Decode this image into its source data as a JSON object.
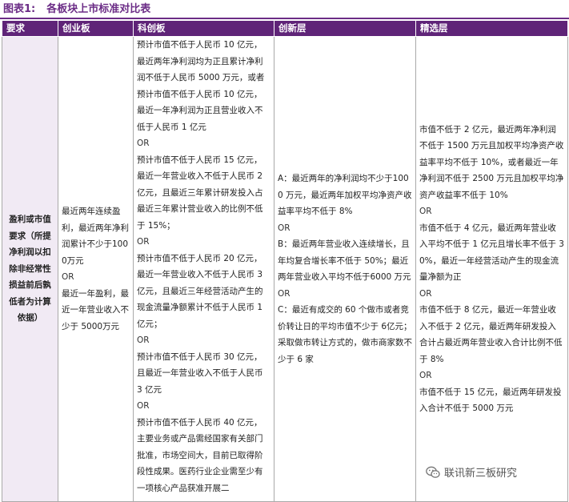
{
  "caption": {
    "label": "图表1:",
    "title": "各板块上市标准对比表"
  },
  "table": {
    "headers": [
      "要求",
      "创业板",
      "科创板",
      "创新层",
      "精选层"
    ],
    "requirement": "盈利或市值要求（所提净利润以扣除非经常性损益前后孰低者为计算依据）",
    "chinext": [
      "最近两年连续盈利，最近两年净利润累计不少于1000万元",
      "OR",
      "最近一年盈利，最近一年营业收入不少于 5000万元"
    ],
    "star": [
      "预计市值不低于人民币 10 亿元，最近两年净利润均为正且累计净利润不低于人民币 5000 万元，或者预计市值不低于人民币 10 亿元，最近一年净利润为正且营业收入不低于人民币 1 亿元",
      "OR",
      "预计市值不低于人民币 15 亿元，最近一年营业收入不低于人民币 2 亿元，且最近三年累计研发投入占最近三年累计营业收入的比例不低于 15%；",
      "OR",
      "预计市值不低于人民币 20 亿元，最近一年营业收入不低于人民币 3 亿元，且最近三年经营活动产生的现金流量净额累计不低于人民币 1 亿元；",
      "OR",
      "预计市值不低于人民币 30 亿元，且最近一年营业收入不低于人民币 3 亿元",
      "OR",
      "预计市值不低于人民币 40 亿元，主要业务或产品需经国家有关部门批准，市场空间大，目前已取得阶段性成果。医药行业企业需至少有一项核心产品获准开展二"
    ],
    "innovation": [
      "A：最近两年的净利润均不少于1000 万元，最近两年加权平均净资产收益率平均不低于 8%",
      "OR",
      "B：最近两年营业收入连续增长，且年均复合增长率不低于 50%；最近两年营业收入平均不低于6000 万元",
      "OR",
      "C：最近有成交的 60 个做市或者竞价转让日的平均市值不少于 6亿元；采取做市转让方式的，做市商家数不少于 6 家"
    ],
    "select": [
      "市值不低于 2 亿元，最近两年净利润不低于 1500 万元且加权平均净资产收益率平均不低于 10%，或者最近一年净利润不低于 2500 万元且加权平均净资产收益率不低于 10%",
      "OR",
      "市值不低于 4 亿元，最近两年营业收入平均不低于 1 亿元且增长率不低于 30%，最近一年经营活动产生的现金流量净额为正",
      "OR",
      "市值不低于 8 亿元，最近一年营业收入不低于 2 亿元，最近两年研发投入合计占最近两年营业收入合计比例不低于 8%",
      "OR",
      "市值不低于 15 亿元，最近两年研发投入合计不低于 5000 万元"
    ]
  },
  "watermark": {
    "icon": "wechat-icon",
    "text": "联讯新三板研究"
  }
}
